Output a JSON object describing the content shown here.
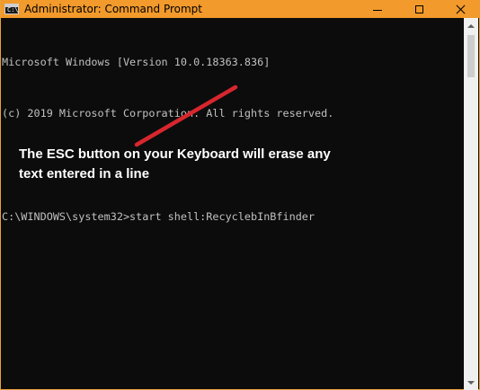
{
  "window": {
    "title": "Administrator: Command Prompt",
    "icon_name": "cmd-icon",
    "icon_text": "C:\\",
    "titlebar_color": "#f29a2b",
    "buttons": {
      "minimize": "minimize-icon",
      "maximize": "maximize-icon",
      "close": "close-icon"
    }
  },
  "console": {
    "lines": [
      "Microsoft Windows [Version 10.0.18363.836]",
      "(c) 2019 Microsoft Corporation. All rights reserved.",
      "",
      "C:\\WINDOWS\\system32>start shell:RecyclebInBfinder"
    ],
    "text_color": "#c0c0c0",
    "background_color": "#0c0c0c"
  },
  "annotation": {
    "text": "The ESC button on your Keyboard will erase any\ntext entered in a line",
    "arrow_color": "#d8262e"
  }
}
